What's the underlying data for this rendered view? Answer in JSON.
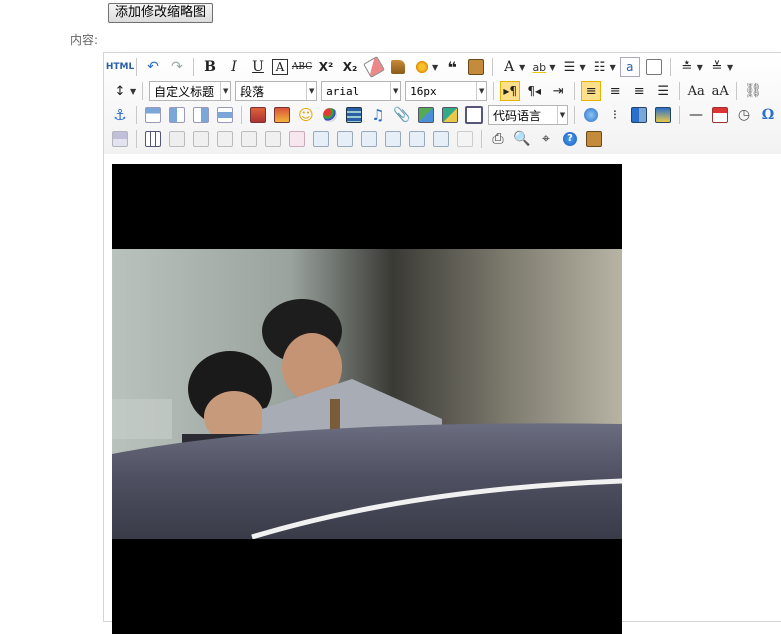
{
  "thumb_button": {
    "label": "添加修改缩略图"
  },
  "content_label": "内容:",
  "toolbar": {
    "source_label": "HTML",
    "custom_title": "自定义标题",
    "paragraph": "段落",
    "font_family": "arial",
    "font_size": "16px",
    "code_language": "代码语言",
    "icons": {
      "bold": "B",
      "italic": "I",
      "underline": "U",
      "font_border": "A",
      "strikethrough": "ABC",
      "superscript": "X²",
      "subscript": "X₂",
      "blockquote": "❝",
      "forecolor": "A",
      "insert_line": "—",
      "omega": "Ω"
    }
  },
  "colors": {
    "active_bg": "#ffe08a",
    "toolbar_bg": "#f2f2f2",
    "video_bg": "#000000"
  }
}
